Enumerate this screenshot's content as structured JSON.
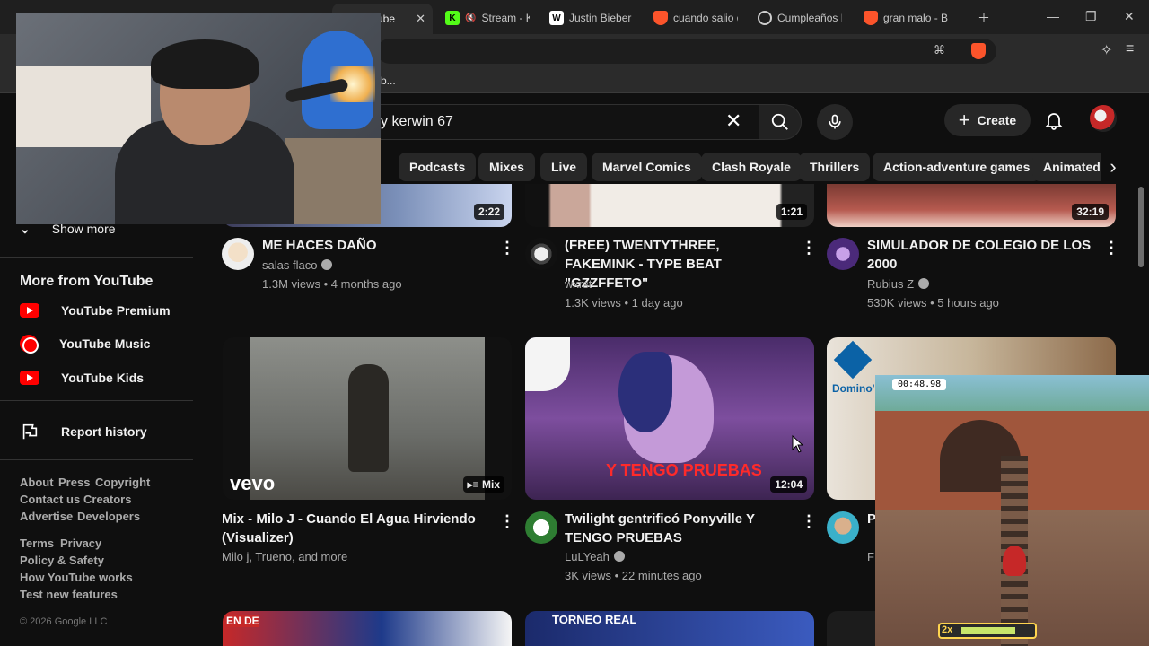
{
  "browser": {
    "tabs": [
      {
        "title": "ube",
        "active": true
      },
      {
        "title": "Stream - K"
      },
      {
        "title": "Justin Bieber -"
      },
      {
        "title": "cuando salio d"
      },
      {
        "title": "Cumpleaños F"
      },
      {
        "title": "gran malo - Br"
      }
    ],
    "bookmark_fragment": "b..."
  },
  "search": {
    "query": "y kerwin 67"
  },
  "header": {
    "create_label": "Create"
  },
  "chips": [
    "Podcasts",
    "Mixes",
    "Live",
    "Marvel Comics",
    "Clash Royale",
    "Thrillers",
    "Action-adventure games",
    "Animated f"
  ],
  "sidebar": {
    "show_more": "Show more",
    "more_heading": "More from YouTube",
    "items": [
      "YouTube Premium",
      "YouTube Music",
      "YouTube Kids"
    ],
    "report": "Report history",
    "links1": [
      "About",
      "Press",
      "Copyright",
      "Contact us",
      "Creators",
      "Advertise",
      "Developers"
    ],
    "links2": [
      "Terms",
      "Privacy",
      "Policy & Safety",
      "How YouTube works",
      "Test new features"
    ],
    "copyright": "© 2026 Google LLC"
  },
  "videos": [
    {
      "title": "ME HACES DAÑO",
      "channel": "salas flaco",
      "meta": "1.3M views • 4 months ago",
      "duration": "2:22"
    },
    {
      "title": "(FREE) TWENTYTHREE, FAKEMINK - TYPE BEAT \"GZZFFETO\"",
      "channel": "wxrst",
      "meta": "1.3K views • 1 day ago",
      "duration": "1:21"
    },
    {
      "title": "SIMULADOR DE COLEGIO DE LOS 2000",
      "channel": "Rubius Z",
      "meta": "530K views • 5 hours ago",
      "duration": "32:19"
    },
    {
      "title": "Mix - Milo J - Cuando El Agua Hirviendo (Visualizer)",
      "channel": "Milo j, Trueno, and more",
      "meta": "",
      "duration": "Mix",
      "thumb_text": "vevo"
    },
    {
      "title": "Twilight gentrificó Ponyville Y TENGO PRUEBAS",
      "channel": "LuLYeah",
      "meta": "3K views • 22 minutes ago",
      "duration": "12:04",
      "thumb_text": "Y TENGO PRUEBAS"
    },
    {
      "title": "P",
      "channel": "F",
      "meta": "",
      "duration": "",
      "thumb_text": "Domino's"
    }
  ],
  "row3_thumb_text": [
    "EN DE",
    "TORNEO REAL"
  ],
  "overlay": {
    "timer": "00:48.98",
    "multiplier": "2x"
  }
}
